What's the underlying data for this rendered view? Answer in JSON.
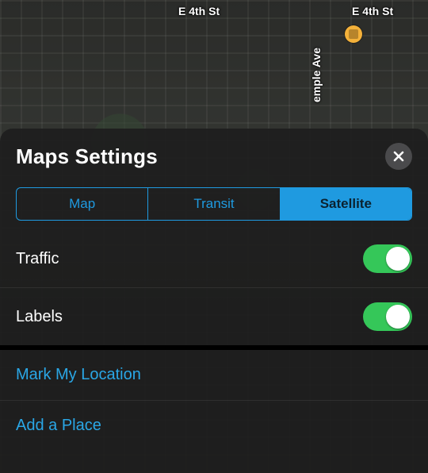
{
  "map": {
    "street1": "E 4th St",
    "street2": "E 4th St",
    "avenue": "emple Ave"
  },
  "sheet": {
    "title": "Maps Settings",
    "segments": {
      "map": "Map",
      "transit": "Transit",
      "satellite": "Satellite",
      "selected": "satellite"
    },
    "toggles": {
      "traffic": {
        "label": "Traffic",
        "on": true
      },
      "labels": {
        "label": "Labels",
        "on": true
      }
    },
    "actions": {
      "mark": "Mark My Location",
      "add": "Add a Place"
    }
  }
}
